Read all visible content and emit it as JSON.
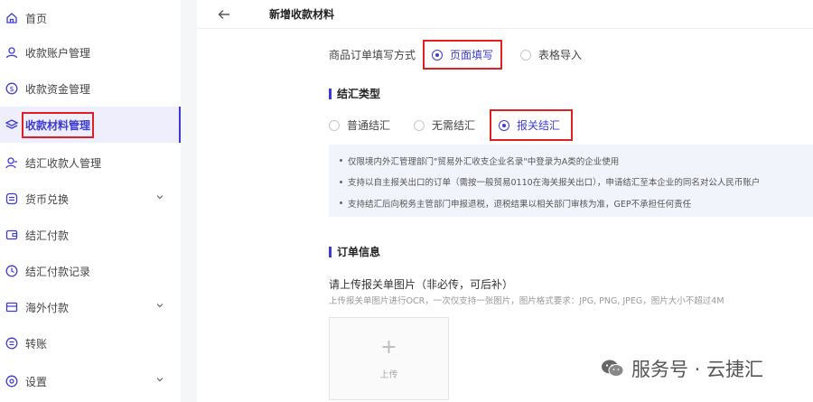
{
  "sidebar": {
    "items": [
      {
        "label": "首页",
        "icon": "home-icon"
      },
      {
        "label": "收款账户管理",
        "icon": "user-icon"
      },
      {
        "label": "收款资金管理",
        "icon": "dollar-icon"
      },
      {
        "label": "收款材料管理",
        "icon": "layers-icon",
        "active": true
      },
      {
        "label": "结汇收款人管理",
        "icon": "person-icon"
      },
      {
        "label": "货币兑换",
        "icon": "exchange-icon",
        "expandable": true
      },
      {
        "label": "结汇付款",
        "icon": "wallet-icon"
      },
      {
        "label": "结汇付款记录",
        "icon": "clock-icon"
      },
      {
        "label": "海外付款",
        "icon": "card-icon",
        "expandable": true
      },
      {
        "label": "转账",
        "icon": "transfer-icon"
      },
      {
        "label": "设置",
        "icon": "settings-icon",
        "expandable": true
      }
    ]
  },
  "header": {
    "title": "新增收款材料"
  },
  "order_fill": {
    "label": "商品订单填写方式",
    "options": [
      "页面填写",
      "表格导入"
    ],
    "selected": "页面填写"
  },
  "settlement": {
    "title": "结汇类型",
    "options": [
      "普通结汇",
      "无需结汇",
      "报关结汇"
    ],
    "selected": "报关结汇",
    "notes": [
      "仅限境内外汇管理部门\"贸易外汇收支企业名录\"中登录为A类的企业使用",
      "支持以自主报关出口的订单（需按一般贸易0110在海关报关出口），申请结汇至本企业的同名对公人民币账户",
      "支持结汇后向税务主管部门申报退税，退税结果以相关部门审核为准，GEP不承担任何责任"
    ]
  },
  "order_info": {
    "title": "订单信息",
    "upload_title": "请上传报关单图片（非必传，可后补）",
    "upload_hint": "上传报关单图片进行OCR，一次仅支持一张图片，图片格式要求：JPG, PNG, JPEG，图片大小不超过4M",
    "upload_label": "上传"
  },
  "watermark": {
    "text": "服务号 · 云捷汇"
  },
  "colors": {
    "accent": "#3d3bd6",
    "highlight": "#e02020"
  }
}
